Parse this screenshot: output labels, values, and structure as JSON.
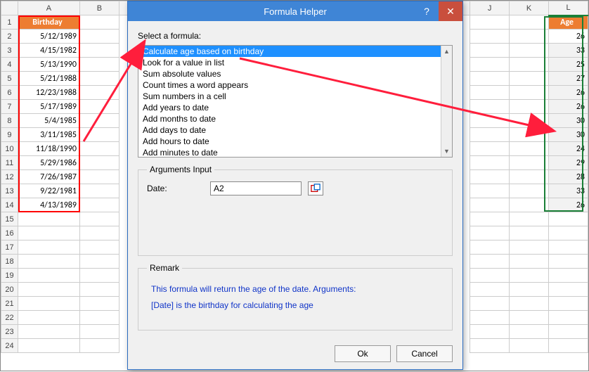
{
  "columns": [
    "A",
    "B",
    "J",
    "K",
    "L"
  ],
  "header_left": "Birthday",
  "header_right": "Age",
  "rows_left": [
    {
      "r": 2,
      "v": "5/12/1989"
    },
    {
      "r": 3,
      "v": "4/15/1982"
    },
    {
      "r": 4,
      "v": "5/13/1990"
    },
    {
      "r": 5,
      "v": "5/21/1988"
    },
    {
      "r": 6,
      "v": "12/23/1988"
    },
    {
      "r": 7,
      "v": "5/17/1989"
    },
    {
      "r": 8,
      "v": "5/4/1985"
    },
    {
      "r": 9,
      "v": "3/11/1985"
    },
    {
      "r": 10,
      "v": "11/18/1990"
    },
    {
      "r": 11,
      "v": "5/29/1986"
    },
    {
      "r": 12,
      "v": "7/26/1987"
    },
    {
      "r": 13,
      "v": "9/22/1981"
    },
    {
      "r": 14,
      "v": "4/13/1989"
    }
  ],
  "rows_right": [
    {
      "r": 2,
      "v": "26"
    },
    {
      "r": 3,
      "v": "33"
    },
    {
      "r": 4,
      "v": "25"
    },
    {
      "r": 5,
      "v": "27"
    },
    {
      "r": 6,
      "v": "26"
    },
    {
      "r": 7,
      "v": "26"
    },
    {
      "r": 8,
      "v": "30"
    },
    {
      "r": 9,
      "v": "30"
    },
    {
      "r": 10,
      "v": "24"
    },
    {
      "r": 11,
      "v": "29"
    },
    {
      "r": 12,
      "v": "28"
    },
    {
      "r": 13,
      "v": "33"
    },
    {
      "r": 14,
      "v": "26"
    }
  ],
  "row_numbers": [
    1,
    2,
    3,
    4,
    5,
    6,
    7,
    8,
    9,
    10,
    11,
    12,
    13,
    14,
    15,
    16,
    17,
    18,
    19,
    20,
    21,
    22,
    23,
    24
  ],
  "dialog": {
    "title": "Formula Helper",
    "select_label": "Select a formula:",
    "options": [
      "Calculate age based on birthday",
      "Look for a value in list",
      "Sum absolute values",
      "Count times a word appears",
      "Sum numbers in a cell",
      "Add years to date",
      "Add months to date",
      "Add days to date",
      "Add hours to date",
      "Add minutes to date"
    ],
    "selected_index": 0,
    "args_legend": "Arguments Input",
    "arg_label": "Date:",
    "arg_value": "A2",
    "remark_legend": "Remark",
    "remark_line1": "This formula will return the age of the date. Arguments:",
    "remark_line2": "[Date] is the birthday for calculating the age",
    "ok": "Ok",
    "cancel": "Cancel",
    "help": "?",
    "close": "✕"
  }
}
